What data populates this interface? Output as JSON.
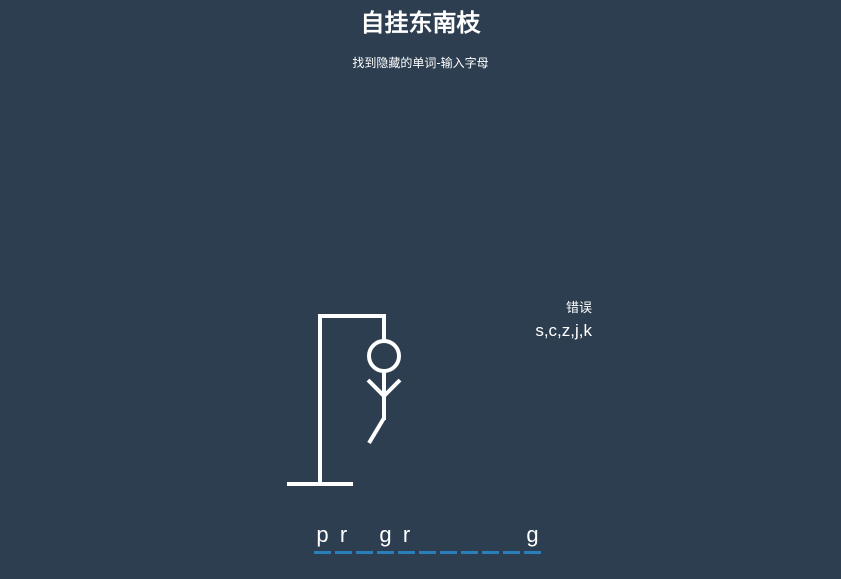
{
  "header": {
    "title": "自挂东南枝",
    "subtitle": "找到隐藏的单词-输入字母"
  },
  "wrong": {
    "label": "错误",
    "letters": "s,c,z,j,k"
  },
  "word": {
    "slots": [
      "p",
      "r",
      "",
      "g",
      "r",
      "",
      "",
      "",
      "",
      "",
      "g"
    ]
  },
  "colors": {
    "background": "#2c3e50",
    "foreground": "#ffffff",
    "underline": "#2980b9"
  },
  "figure": {
    "parts_shown": [
      "head",
      "body",
      "left-arm",
      "right-arm",
      "left-leg"
    ]
  }
}
